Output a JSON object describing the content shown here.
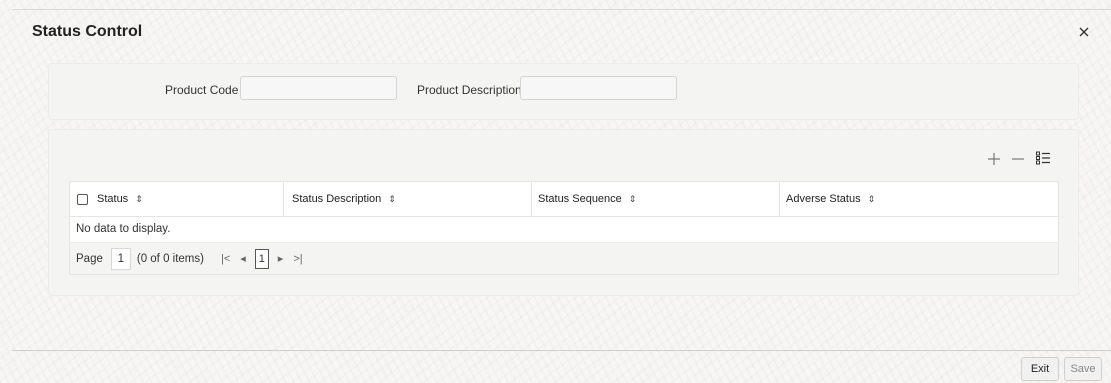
{
  "window": {
    "title": "Status Control"
  },
  "header_panel": {
    "product_code_label": "Product Code",
    "product_code_value": "",
    "product_description_label": "Product Description",
    "product_description_value": ""
  },
  "grid": {
    "toolbar_icons": [
      "plus-icon",
      "minus-icon",
      "list-settings-icon"
    ],
    "columns": [
      {
        "label": "Status"
      },
      {
        "label": "Status Description"
      },
      {
        "label": "Status Sequence"
      },
      {
        "label": "Adverse Status"
      }
    ],
    "sort_glyph": "⇕",
    "empty_message": "No data to display.",
    "pager": {
      "page_label": "Page",
      "page_value": "1",
      "items_text": "(0 of 0 items)",
      "current_page": "1",
      "first_glyph": "|<",
      "prev_glyph": "◂",
      "next_glyph": "▸",
      "last_glyph": ">|"
    }
  },
  "footer": {
    "exit_label": "Exit",
    "save_label": "Save"
  },
  "colors": {
    "background": "#f7f6f4",
    "panel": "#f4f4f3",
    "border": "#e4e4e4"
  }
}
